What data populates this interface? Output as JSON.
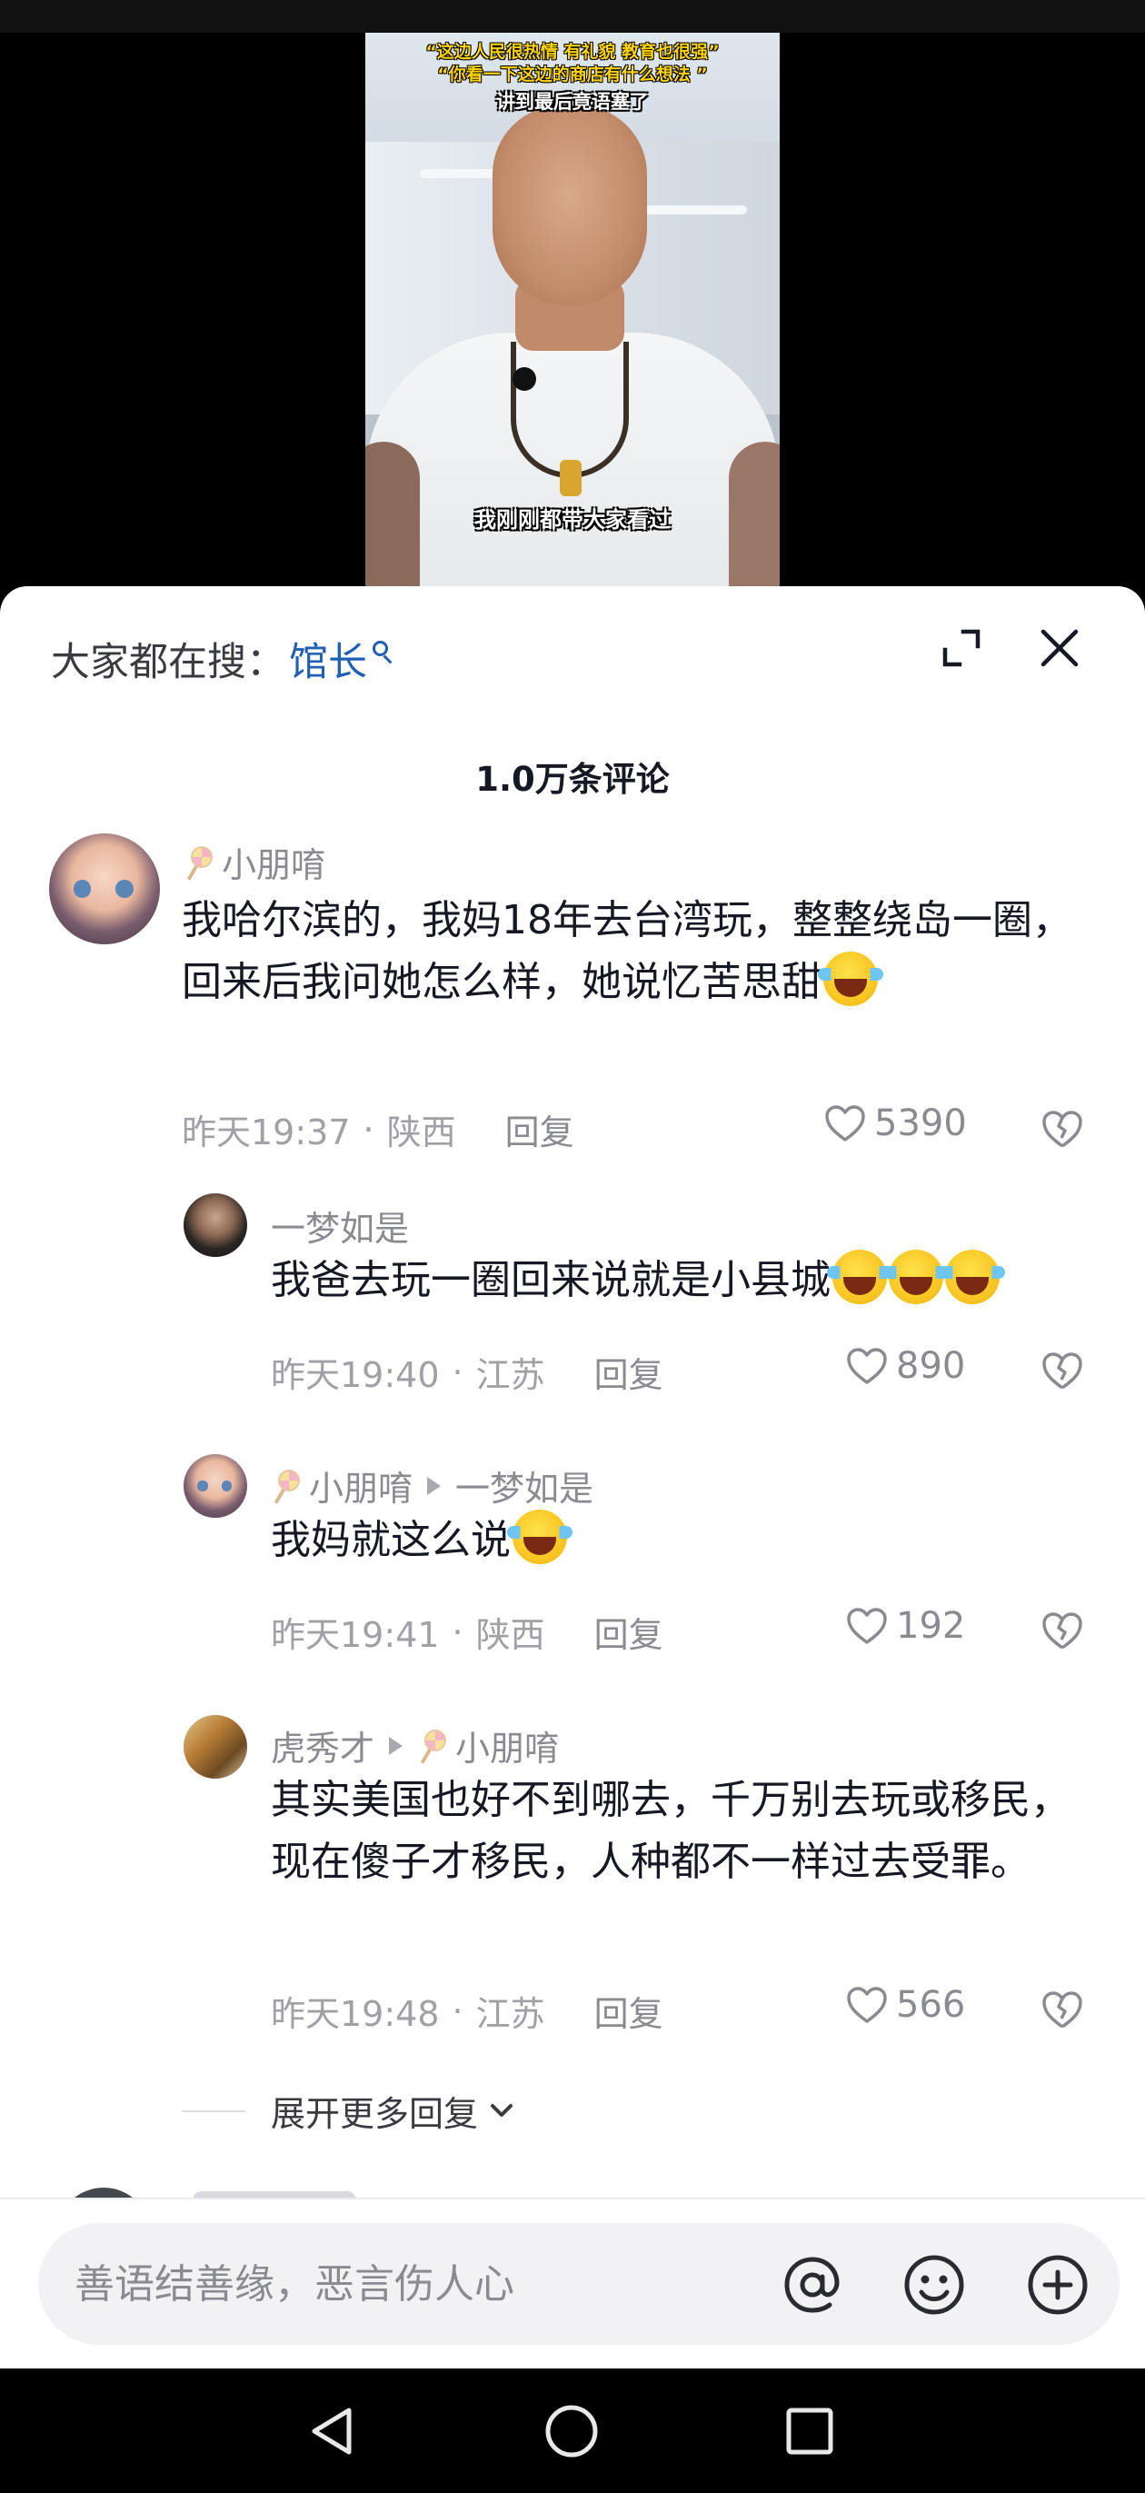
{
  "video": {
    "caption_line1": "“这边人民很热情 有礼貌 教育也很强”",
    "caption_line2": "“你看一下这边的商店有什么想法 ”",
    "caption_line3": "讲到最后竟语塞了",
    "subtitle": "我刚刚都带大家看过"
  },
  "header": {
    "search_prefix": "大家都在搜：",
    "search_term": "馆长",
    "comment_count": "1.0万条评论"
  },
  "comments": [
    {
      "nickname": "小朋唷",
      "text": "我哈尔滨的，我妈18年去台湾玩，整整绕岛一圈，回来后我问她怎么样，她说忆苦思甜",
      "time": "昨天19:37",
      "location": "陕西",
      "reply_label": "回复",
      "likes": "5390"
    },
    {
      "nickname": "一梦如是",
      "text": "我爸去玩一圈回来说就是小县城",
      "time": "昨天19:40",
      "location": "江苏",
      "reply_label": "回复",
      "likes": "890"
    },
    {
      "nickname": "小朋唷",
      "reply_to": "一梦如是",
      "text": "我妈就这么说",
      "time": "昨天19:41",
      "location": "陕西",
      "reply_label": "回复",
      "likes": "192"
    },
    {
      "nickname": "虎秀才",
      "reply_to": "小朋唷",
      "text": "其实美国也好不到哪去，千万别去玩或移民，现在傻子才移民，人种都不一样过去受罪。",
      "time": "昨天19:48",
      "location": "江苏",
      "reply_label": "回复",
      "likes": "566"
    }
  ],
  "expand_more_label": "展开更多回复",
  "input": {
    "placeholder": "善语结善缘，恶言伤人心"
  },
  "icons": {
    "expand": "expand-icon",
    "close": "close-icon",
    "like": "heart-icon",
    "dislike": "broken-heart-icon",
    "mention": "at-icon",
    "emoji": "smiley-icon",
    "add": "plus-circle-icon",
    "nav_back": "triangle-back-icon",
    "nav_home": "circle-home-icon",
    "nav_recent": "square-recent-icon"
  },
  "colors": {
    "search_term": "#1f5fb4",
    "caption_yellow": "#ffd400"
  }
}
